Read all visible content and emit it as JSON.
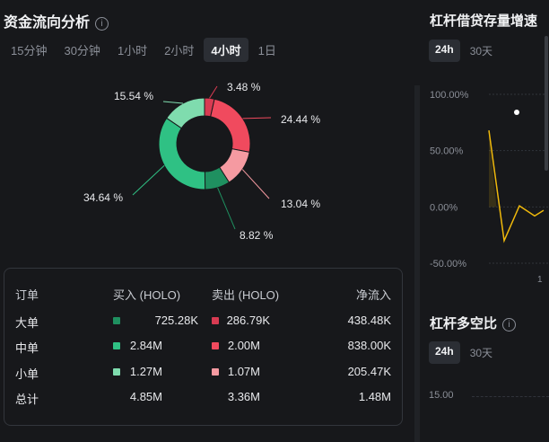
{
  "left": {
    "title": "资金流向分析",
    "tabs": [
      "15分钟",
      "30分钟",
      "1小时",
      "2小时",
      "4小时",
      "1日"
    ],
    "active_tab": 4,
    "donut": {
      "slices": [
        {
          "label": "3.48 %",
          "value": 3.48,
          "color": "#d83b52"
        },
        {
          "label": "24.44 %",
          "value": 24.44,
          "color": "#f04a5e"
        },
        {
          "label": "13.04 %",
          "value": 13.04,
          "color": "#f59aa1"
        },
        {
          "label": "8.82 %",
          "value": 8.82,
          "color": "#1f9060"
        },
        {
          "label": "34.64 %",
          "value": 34.64,
          "color": "#2fc184"
        },
        {
          "label": "15.54 %",
          "value": 15.54,
          "color": "#7fdcae"
        }
      ]
    },
    "table": {
      "headers": [
        "订单",
        "买入 (HOLO)",
        "卖出 (HOLO)",
        "净流入"
      ],
      "rows": [
        {
          "name": "大单",
          "buy": "725.28K",
          "buy_color": "#1f9060",
          "sell": "286.79K",
          "sell_color": "#d83b52",
          "net": "438.48K"
        },
        {
          "name": "中单",
          "buy": "2.84M",
          "buy_color": "#2fc184",
          "sell": "2.00M",
          "sell_color": "#f04a5e",
          "net": "838.00K"
        },
        {
          "name": "小单",
          "buy": "1.27M",
          "buy_color": "#7fdcae",
          "sell": "1.07M",
          "sell_color": "#f59aa1",
          "net": "205.47K"
        },
        {
          "name": "总计",
          "buy": "4.85M",
          "sell": "3.36M",
          "net": "1.48M"
        }
      ]
    }
  },
  "right": {
    "title1": "杠杆借贷存量增速",
    "tabs1": [
      "24h",
      "30天"
    ],
    "title2": "杠杆多空比",
    "tabs2": [
      "24h",
      "30天"
    ],
    "chart_data": {
      "type": "line",
      "y_ticks": [
        "100.00%",
        "50.00%",
        "0.00%",
        "-50.00%"
      ],
      "ylim": [
        -50,
        100
      ],
      "x_tick": "1",
      "color": "#f0b90b",
      "values": [
        68,
        -30,
        1,
        -8,
        -3
      ]
    },
    "chart2_y_tick": "15.00"
  }
}
